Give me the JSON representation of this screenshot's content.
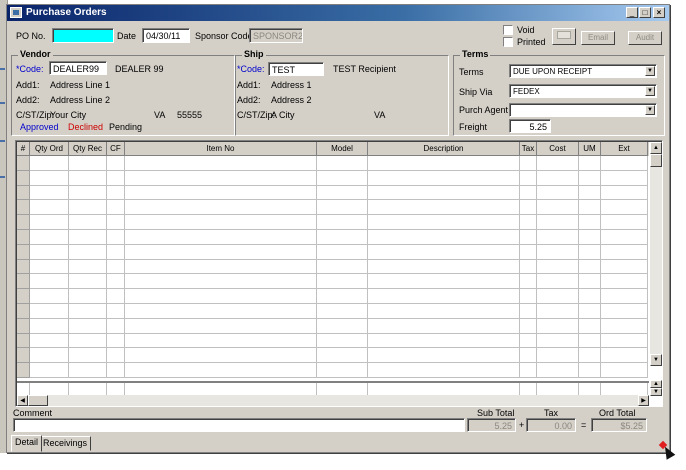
{
  "window": {
    "title": "Purchase Orders"
  },
  "header": {
    "po_no_label": "PO No.",
    "po_no_value": "",
    "date_label": "Date",
    "date_value": "04/30/11",
    "sponsor_code_label": "Sponsor Code",
    "sponsor_code_value": "SPONSOR2",
    "void_label": "Void",
    "printed_label": "Printed",
    "email_button": "Email",
    "audit_button": "Audit"
  },
  "vendor": {
    "title": "Vendor",
    "code_label": "*Code:",
    "code_value": "DEALER99",
    "name": "DEALER 99",
    "add1_label": "Add1:",
    "add1_value": "Address Line 1",
    "add2_label": "Add2:",
    "add2_value": "Address Line 2",
    "cst_label": "C/ST/Zip:",
    "city": "Your City",
    "state": "VA",
    "zip": "55555",
    "status_approved": "Approved",
    "status_declined": "Declined",
    "status_pending": "Pending"
  },
  "ship": {
    "title": "Ship",
    "code_label": "*Code:",
    "code_value": "TEST",
    "name": "TEST Recipient",
    "add1_label": "Add1:",
    "add1_value": "Address 1",
    "add2_label": "Add2:",
    "add2_value": "Address 2",
    "cst_label": "C/ST/Zip:",
    "city": "A City",
    "state": "VA"
  },
  "terms": {
    "title": "Terms",
    "terms_label": "Terms",
    "terms_value": "DUE UPON RECEIPT",
    "ship_via_label": "Ship Via",
    "ship_via_value": "FEDEX",
    "purch_agent_label": "Purch Agent",
    "purch_agent_value": "",
    "freight_label": "Freight",
    "freight_value": "5.25"
  },
  "grid": {
    "columns": [
      "#",
      "Qty Ord",
      "Qty Rec",
      "CF",
      "Item No",
      "Model",
      "Description",
      "Tax",
      "Cost",
      "UM",
      "Ext"
    ]
  },
  "footer": {
    "comment_label": "Comment",
    "comment_value": "",
    "subtotal_label": "Sub Total",
    "subtotal_value": "5.25",
    "plus": "+",
    "tax_label": "Tax",
    "tax_value": "0.00",
    "equals": "=",
    "ord_total_label": "Ord Total",
    "ord_total_value": "$5.25"
  },
  "tabs": [
    "Detail",
    "Receivings"
  ]
}
